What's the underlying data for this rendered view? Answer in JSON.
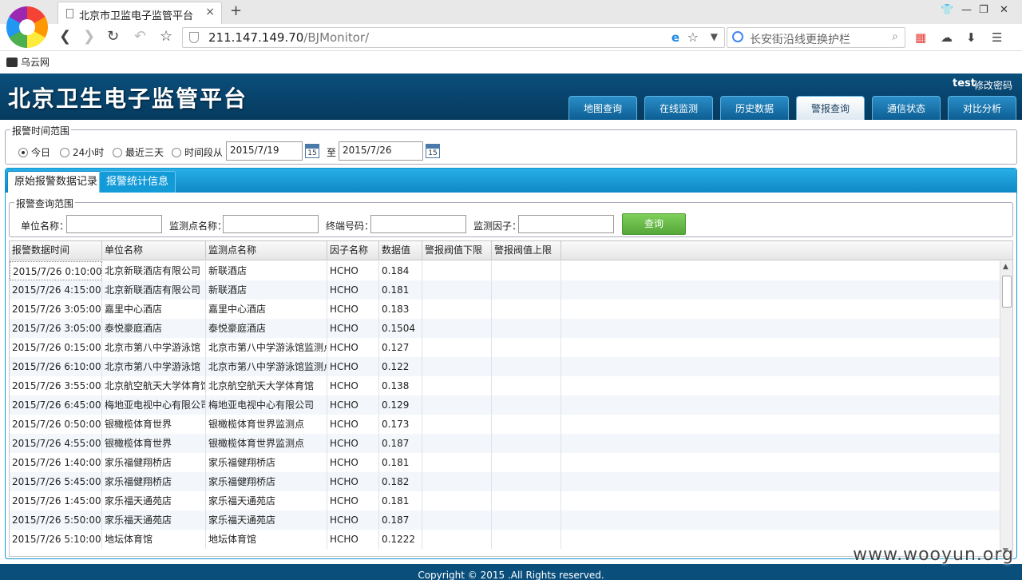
{
  "browser": {
    "tab_title": "北京市卫监电子监管平台",
    "tab_close": "×",
    "new_tab": "+",
    "url_host": "211.147.149.70",
    "url_path": "/BJMonitor/",
    "search_placeholder": "长安街沿线更换护栏",
    "bookmark": "乌云网"
  },
  "header": {
    "title": "北京卫生电子监管平台",
    "user": "test",
    "change_password": "修改密码",
    "nav": [
      {
        "label": "地图查询",
        "active": false
      },
      {
        "label": "在线监测",
        "active": false
      },
      {
        "label": "历史数据",
        "active": false
      },
      {
        "label": "警报查询",
        "active": true
      },
      {
        "label": "通信状态",
        "active": false
      },
      {
        "label": "对比分析",
        "active": false
      }
    ]
  },
  "time_range": {
    "legend": "报警时间范围",
    "options": [
      {
        "label": "今日",
        "checked": true
      },
      {
        "label": "24小时",
        "checked": false
      },
      {
        "label": "最近三天",
        "checked": false
      },
      {
        "label": "时间段从",
        "checked": false
      }
    ],
    "from": "2015/7/19",
    "to_label": "至",
    "to": "2015/7/26",
    "cal_icon_text": "15"
  },
  "panel": {
    "tabs": [
      {
        "label": "原始报警数据记录",
        "active": true
      },
      {
        "label": "报警统计信息",
        "active": false
      }
    ]
  },
  "query": {
    "legend": "报警查询范围",
    "unit_label": "单位名称：",
    "site_label": "监测点名称：",
    "terminal_label": "终端号码：",
    "factor_label": "监测因子：",
    "button": "查询"
  },
  "grid": {
    "columns": [
      "报警数据时间",
      "单位名称",
      "监测点名称",
      "因子名称",
      "数据值",
      "警报阀值下限",
      "警报阀值上限"
    ],
    "rows": [
      [
        "2015/7/26 0:10:00",
        "北京新联酒店有限公司",
        "新联酒店",
        "HCHO",
        "0.184",
        "",
        ""
      ],
      [
        "2015/7/26 4:15:00",
        "北京新联酒店有限公司",
        "新联酒店",
        "HCHO",
        "0.181",
        "",
        ""
      ],
      [
        "2015/7/26 3:05:00",
        "嘉里中心酒店",
        "嘉里中心酒店",
        "HCHO",
        "0.183",
        "",
        ""
      ],
      [
        "2015/7/26 3:05:00",
        "泰悦豪庭酒店",
        "泰悦豪庭酒店",
        "HCHO",
        "0.1504",
        "",
        ""
      ],
      [
        "2015/7/26 0:15:00",
        "北京市第八中学游泳馆",
        "北京市第八中学游泳馆监测点",
        "HCHO",
        "0.127",
        "",
        ""
      ],
      [
        "2015/7/26 6:10:00",
        "北京市第八中学游泳馆",
        "北京市第八中学游泳馆监测点",
        "HCHO",
        "0.122",
        "",
        ""
      ],
      [
        "2015/7/26 3:55:00",
        "北京航空航天大学体育馆",
        "北京航空航天大学体育馆",
        "HCHO",
        "0.138",
        "",
        ""
      ],
      [
        "2015/7/26 6:45:00",
        "梅地亚电视中心有限公司",
        "梅地亚电视中心有限公司",
        "HCHO",
        "0.129",
        "",
        ""
      ],
      [
        "2015/7/26 0:50:00",
        "银橄榄体育世界",
        "银橄榄体育世界监测点",
        "HCHO",
        "0.173",
        "",
        ""
      ],
      [
        "2015/7/26 4:55:00",
        "银橄榄体育世界",
        "银橄榄体育世界监测点",
        "HCHO",
        "0.187",
        "",
        ""
      ],
      [
        "2015/7/26 1:40:00",
        "家乐福健翔桥店",
        "家乐福健翔桥店",
        "HCHO",
        "0.181",
        "",
        ""
      ],
      [
        "2015/7/26 5:45:00",
        "家乐福健翔桥店",
        "家乐福健翔桥店",
        "HCHO",
        "0.182",
        "",
        ""
      ],
      [
        "2015/7/26 1:45:00",
        "家乐福天通苑店",
        "家乐福天通苑店",
        "HCHO",
        "0.181",
        "",
        ""
      ],
      [
        "2015/7/26 5:50:00",
        "家乐福天通苑店",
        "家乐福天通苑店",
        "HCHO",
        "0.187",
        "",
        ""
      ],
      [
        "2015/7/26 5:10:00",
        "地坛体育馆",
        "地坛体育馆",
        "HCHO",
        "0.1222",
        "",
        ""
      ]
    ]
  },
  "footer": "Copyright © 2015 .All Rights reserved.",
  "watermark": "www.wooyun.org"
}
